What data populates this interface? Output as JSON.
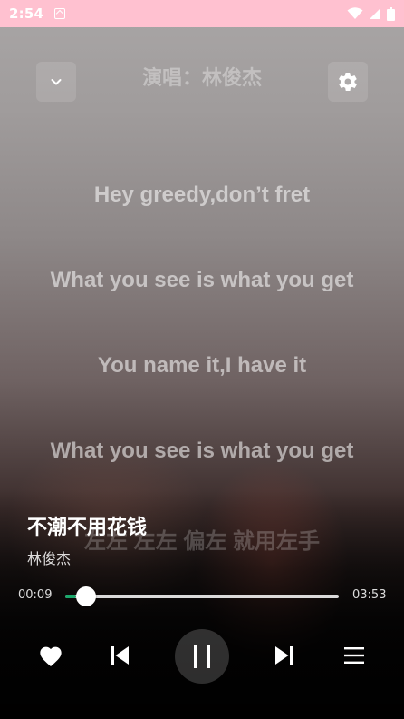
{
  "status_bar": {
    "time": "2:54",
    "icons": [
      "app-notification-icon",
      "wifi-icon",
      "signal-icon",
      "battery-icon"
    ]
  },
  "top_controls": {
    "collapse_icon": "chevron-down-icon",
    "settings_icon": "gear-icon"
  },
  "lyrics": {
    "singer_line": "演唱：林俊杰",
    "lines": [
      "Hey greedy,don’t fret",
      "What you see is what you get",
      "You name it,I have it",
      "What you see is what you get",
      "左左 左左 偏左 就用左手"
    ]
  },
  "song": {
    "title": "不潮不用花钱",
    "artist": "林俊杰"
  },
  "progress": {
    "elapsed": "00:09",
    "total": "03:53",
    "fraction": 0.04
  },
  "controls": {
    "like_icon": "heart-icon",
    "prev_icon": "skip-previous-icon",
    "play_state_icon": "pause-icon",
    "next_icon": "skip-next-icon",
    "playlist_icon": "menu-list-icon"
  },
  "colors": {
    "status_bar": "#ffc1d0",
    "progress_fill": "#1aa86b",
    "lyric_text": "rgba(255,255,255,0.55)"
  }
}
